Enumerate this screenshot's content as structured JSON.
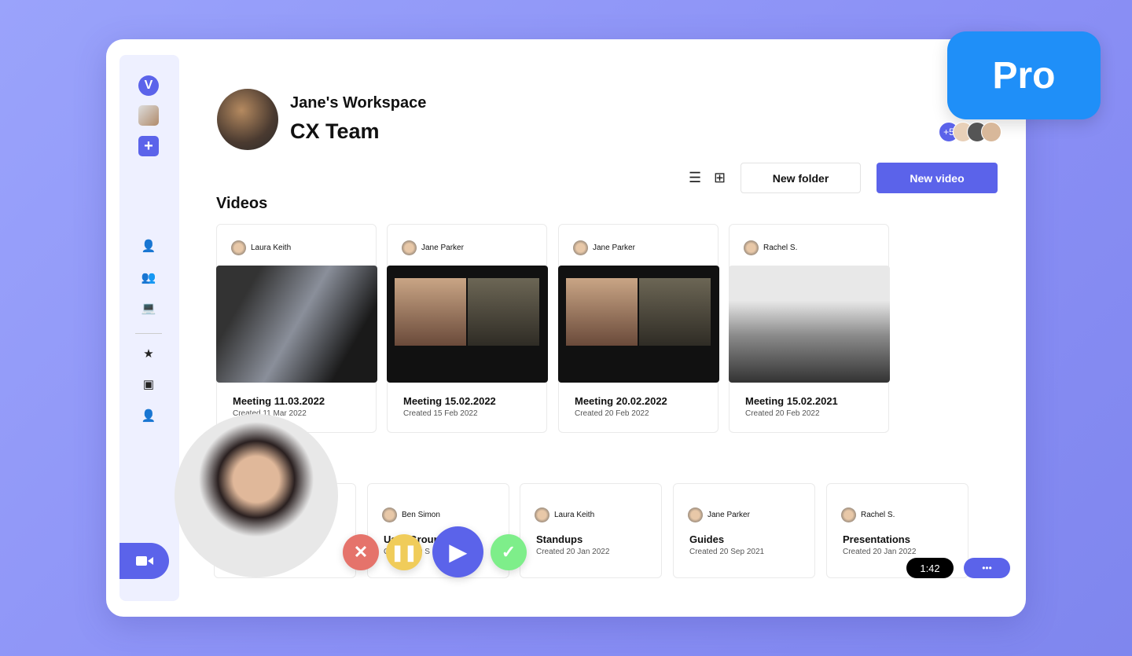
{
  "badge": "Pro",
  "sidebar": {
    "logo": "V",
    "add": "+",
    "icons": [
      "user-icon",
      "users-icon",
      "screen-icon",
      "star-icon",
      "archive-icon",
      "user-settings-icon"
    ]
  },
  "workspace": {
    "name": "Jane's Workspace",
    "team": "CX Team",
    "extra_members": "+5"
  },
  "toolbar": {
    "new_folder": "New folder",
    "new_video": "New video"
  },
  "videos": {
    "title": "Videos",
    "items": [
      {
        "author": "Laura Keith",
        "title": "Meeting 11.03.2022",
        "created": "Created 11 Mar 2022"
      },
      {
        "author": "Jane Parker",
        "title": "Meeting 15.02.2022",
        "created": "Created 15 Feb 2022"
      },
      {
        "author": "Jane Parker",
        "title": "Meeting 20.02.2022",
        "created": "Created 20 Feb 2022"
      },
      {
        "author": "Rachel S.",
        "title": "Meeting 15.02.2021",
        "created": "Created 20 Feb 2022"
      }
    ]
  },
  "folders": [
    {
      "author": "Ben Simon",
      "title": "User Groups",
      "created": "Created 20 S"
    },
    {
      "author": "Laura Keith",
      "title": "Standups",
      "created": "Created 20 Jan 2022"
    },
    {
      "author": "Jane Parker",
      "title": "Guides",
      "created": "Created 20 Sep 2021"
    },
    {
      "author": "Rachel S.",
      "title": "Presentations",
      "created": "Created 20 Jan 2022"
    }
  ],
  "recorder": {
    "timer": "1:42",
    "more": "•••"
  },
  "colors": {
    "accent": "#5b63ea",
    "pro": "#1f8ff8",
    "cancel": "#e5736b",
    "pause": "#f0cc5a",
    "confirm": "#7eee8a"
  }
}
